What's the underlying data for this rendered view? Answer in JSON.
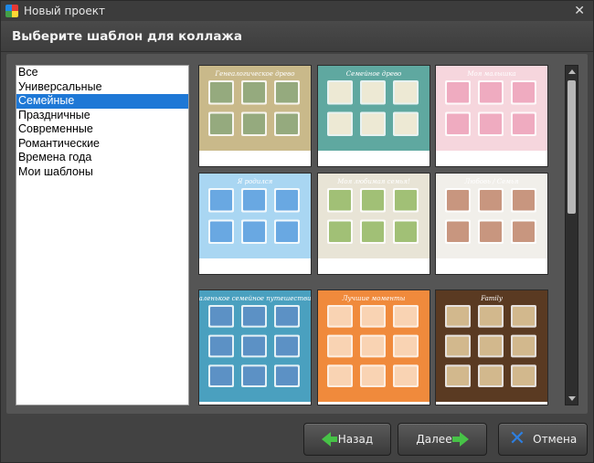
{
  "window": {
    "title": "Новый проект",
    "close_icon": "close-icon"
  },
  "header": {
    "title": "Выберите шаблон для коллажа"
  },
  "categories": [
    {
      "label": "Все",
      "selected": false
    },
    {
      "label": "Универсальные",
      "selected": false
    },
    {
      "label": "Семейные",
      "selected": true
    },
    {
      "label": "Праздничные",
      "selected": false
    },
    {
      "label": "Современные",
      "selected": false
    },
    {
      "label": "Романтические",
      "selected": false
    },
    {
      "label": "Времена года",
      "selected": false
    },
    {
      "label": "Мои шаблоны",
      "selected": false
    }
  ],
  "templates": [
    {
      "bg": "#c9b98a",
      "accent": "#6b8a4e",
      "heading": "Генеалогическое древо"
    },
    {
      "bg": "#5fa8a0",
      "accent": "#f0e6c8",
      "heading": "Семейное древо"
    },
    {
      "bg": "#f6d6dd",
      "accent": "#e88aa6",
      "heading": "Моя малышка"
    },
    {
      "bg": "#a9d6f2",
      "accent": "#2f86d6",
      "heading": "Я родился"
    },
    {
      "bg": "#e8e4d6",
      "accent": "#7ba73e",
      "heading": "Моя любимая семья!"
    },
    {
      "bg": "#f1efea",
      "accent": "#b06a4a",
      "heading": "Любовь / Семья"
    },
    {
      "bg": "#4aa0bf",
      "accent": "#2268b0",
      "heading": "Маленькое семейное путешествие!"
    },
    {
      "bg": "#f08a3c",
      "accent": "#f6c8a0",
      "heading": "Лучшие моменты"
    },
    {
      "bg": "#5a3a22",
      "accent": "#c9a66b",
      "heading": "Family"
    }
  ],
  "buttons": {
    "back": "Назад",
    "next": "Далее",
    "cancel": "Отмена"
  },
  "colors": {
    "selection": "#1e78d6",
    "panel": "#555555",
    "green_arrow": "#47c247",
    "blue_x": "#2d7fe0"
  }
}
